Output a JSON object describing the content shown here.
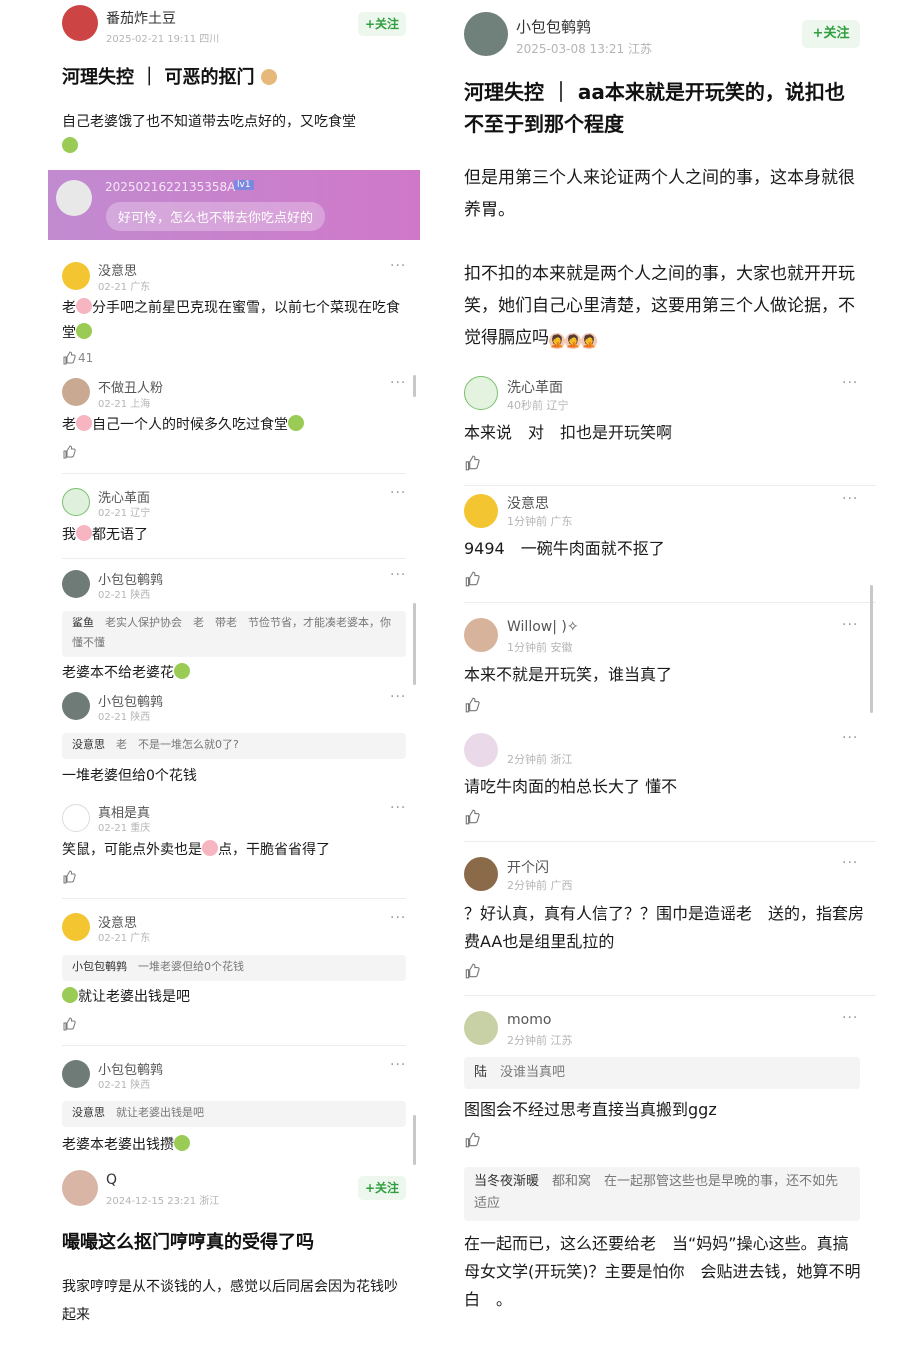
{
  "left": {
    "post": {
      "author": "番茄炸土豆",
      "time_loc": "2025-02-21 19:11 四川",
      "follow": "+关注",
      "title": "河理失控 ｜ 可恶的抠门",
      "body": "自己老婆饿了也不知道带去吃点好的，又吃食堂"
    },
    "banner": {
      "user": "2025021622135358A",
      "level": "lv1",
      "text": "好可怜，怎么也不带去你吃点好的"
    },
    "comments": [
      {
        "name": "没意思",
        "meta": "02-21 广东",
        "text1": "老",
        "text2": "分手吧之前星巴克现在蜜雪，以前七个菜现在吃食堂",
        "likes": "41"
      },
      {
        "name": "不做丑人粉",
        "meta": "02-21 上海",
        "text1": "老",
        "text2": "自己一个人的时候多久吃过食堂"
      },
      {
        "name": "洗心革面",
        "meta": "02-21 辽宁",
        "text1": "我",
        "text2": "都无语了"
      },
      {
        "name": "小包包鹌鹑",
        "meta": "02-21 陕西",
        "quote_user": "鲨鱼",
        "quote_text": "老实人保护协会　老　带老　节俭节省，才能凑老婆本，你懂不懂",
        "text": "老婆本不给老婆花"
      },
      {
        "name": "小包包鹌鹑",
        "meta": "02-21 陕西",
        "quote_user": "没意思",
        "quote_text": "老　不是一堆怎么就0了?",
        "text": "一堆老婆但给0个花钱"
      },
      {
        "name": "真相是真",
        "meta": "02-21 重庆",
        "text1": "笑鼠，可能点外卖也是",
        "text2": "点，干脆省省得了"
      },
      {
        "name": "没意思",
        "meta": "02-21 广东",
        "quote_user": "小包包鹌鹑",
        "quote_text": "一堆老婆但给0个花钱",
        "text": "就让老婆出钱是吧"
      },
      {
        "name": "小包包鹌鹑",
        "meta": "02-21 陕西",
        "quote_user": "没意思",
        "quote_text": "就让老婆出钱是吧",
        "text": "老婆本老婆出钱攒"
      }
    ],
    "post2": {
      "author": "Q",
      "time_loc": "2024-12-15 23:21 浙江",
      "follow": "+关注",
      "title": "嘬嘬这么抠门哼哼真的受得了吗",
      "body": "我家哼哼是从不谈钱的人，感觉以后同居会因为花钱吵起来"
    }
  },
  "right": {
    "post": {
      "author": "小包包鹌鹑",
      "time_loc": "2025-03-08 13:21 江苏",
      "follow": "+关注",
      "title": "河理失控 ｜ aa本来就是开玩笑的，说扣也不至于到那个程度",
      "body1": "但是用第三个人来论证两个人之间的事，这本身就很养胃。",
      "body2": "扣不扣的本来就是两个人之间的事，大家也就开开玩笑，她们自己心里清楚，这要用第三个人做论据，不觉得膈应吗"
    },
    "comments": [
      {
        "name": "洗心革面",
        "meta": "40秒前 辽宁",
        "text": "本来说　对　扣也是开玩笑啊"
      },
      {
        "name": "没意思",
        "meta": "1分钟前 广东",
        "text": "9494　一碗牛肉面就不抠了"
      },
      {
        "name": "Willow|  )✧",
        "meta": "1分钟前 安徽",
        "text": "本来不就是开玩笑，谁当真了"
      },
      {
        "name": "",
        "meta": "2分钟前 浙江",
        "text": "请吃牛肉面的柏总长大了 懂不"
      },
      {
        "name": "开个闪",
        "meta": "2分钟前 广西",
        "text": "？好认真，真有人信了？？围巾是造谣老　送的，指套房费AA也是组里乱拉的"
      },
      {
        "name": "momo",
        "meta": "2分钟前 江苏",
        "quote_user": "陆",
        "quote_text": "没谁当真吧",
        "text": "图图会不经过思考直接当真搬到ggz"
      }
    ],
    "last": {
      "quote_user": "当冬夜渐暖",
      "quote_text": "都和窝　在一起那管这些也是早晚的事，还不如先适应",
      "text": "在一起而已，这么还要给老　当“妈妈”操心这些。真搞母女文学(开玩笑)？主要是怕你　会贴进去钱，她算不明白　。"
    }
  },
  "colors": {
    "follow_green": "#2e9f3e",
    "banner_purple": "#c87bd0"
  }
}
